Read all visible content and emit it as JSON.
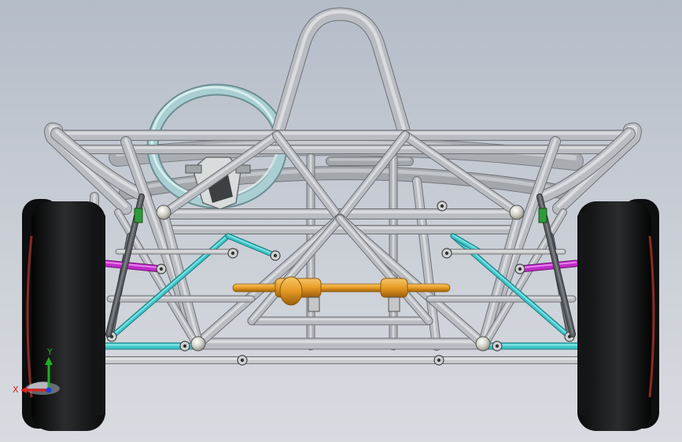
{
  "viewport": {
    "background_top": "#b4bcc8",
    "background_bottom": "#d8dbe0"
  },
  "model": {
    "frame_color": "#b9bcc0",
    "frame_highlight": "#e4e6e8",
    "frame_shadow": "#6e7277",
    "steering_wheel_color": "#a9cfd3",
    "lower_arm_color": "#3fc4c8",
    "upper_arm_color": "#c02cc8",
    "steering_rack_color": "#e69a22",
    "tire_color": "#161718",
    "rim_accent_color": "#c0392b"
  },
  "triad": {
    "x_label": "X",
    "y_label": "Y",
    "x_color": "#e02020",
    "y_color": "#20b020",
    "z_color": "#2040e0"
  }
}
